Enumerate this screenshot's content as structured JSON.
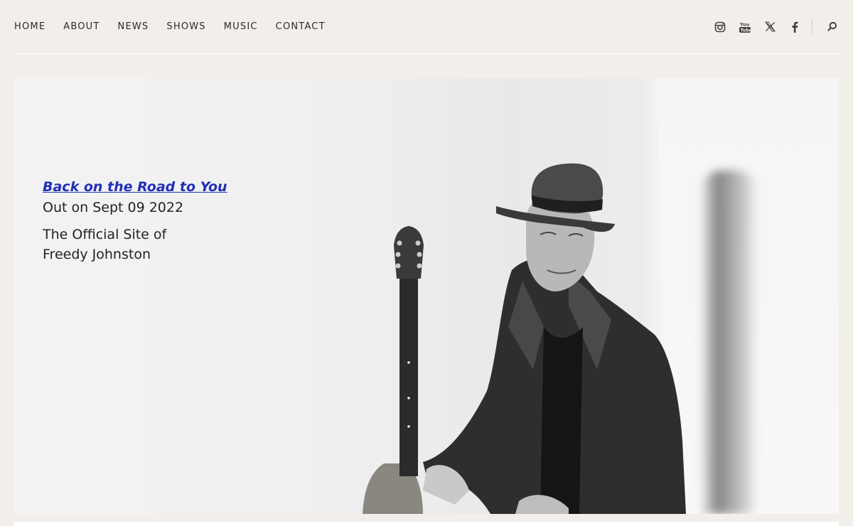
{
  "nav": {
    "items": [
      {
        "label": "HOME"
      },
      {
        "label": "ABOUT"
      },
      {
        "label": "NEWS"
      },
      {
        "label": "SHOWS"
      },
      {
        "label": "MUSIC"
      },
      {
        "label": "CONTACT"
      }
    ]
  },
  "social": {
    "icons": [
      "instagram-icon",
      "youtube-icon",
      "x-icon",
      "facebook-icon",
      "search-icon"
    ]
  },
  "hero": {
    "album_link": "Back on the Road to You",
    "release": "Out on Sept 09 2022",
    "tagline_line1": "The Official Site of",
    "tagline_line2": "Freedy Johnston"
  },
  "colors": {
    "background": "#f2efea",
    "link": "#2130b8",
    "text": "#222222"
  }
}
